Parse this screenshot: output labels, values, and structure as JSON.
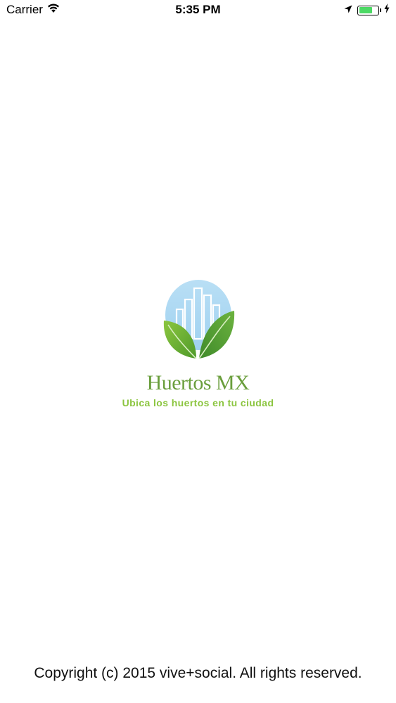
{
  "status_bar": {
    "carrier": "Carrier",
    "time": "5:35 PM",
    "icons": [
      "wifi-icon",
      "location-arrow-icon",
      "battery-icon",
      "charging-bolt-icon"
    ],
    "battery_level": 0.75,
    "battery_color": "#4cd964"
  },
  "splash": {
    "brand_name": "Huertos MX",
    "tagline": "Ubica los huertos en tu ciudad",
    "brand_color": "#6a9e3c",
    "tagline_color": "#8bc53f",
    "logo_icon": "leaves-city-logo-icon"
  },
  "footer": {
    "copyright": "Copyright (c) 2015 vive+social. All rights reserved."
  }
}
